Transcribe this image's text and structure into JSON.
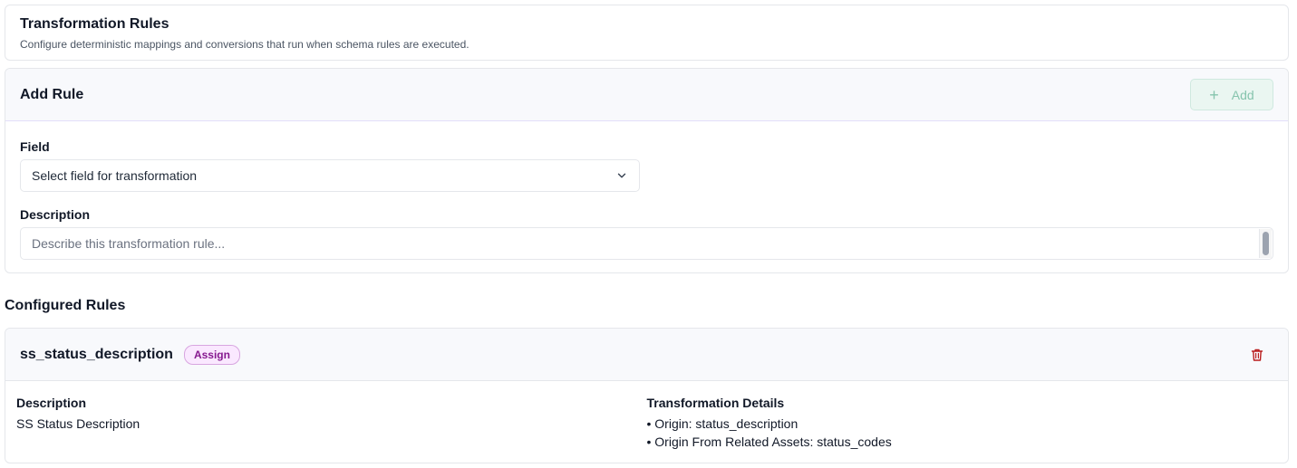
{
  "header": {
    "title": "Transformation Rules",
    "subtitle": "Configure deterministic mappings and conversions that run when schema rules are executed."
  },
  "add_rule": {
    "title": "Add Rule",
    "add_button_label": "Add",
    "field_label": "Field",
    "field_placeholder": "Select field for transformation",
    "description_label": "Description",
    "description_placeholder": "Describe this transformation rule..."
  },
  "configured": {
    "title": "Configured Rules",
    "rules": [
      {
        "name": "ss_status_description",
        "badge": "Assign",
        "description_label": "Description",
        "description": "SS Status Description",
        "details_label": "Transformation Details",
        "details": [
          "• Origin: status_description",
          "• Origin From Related Assets: status_codes"
        ]
      }
    ]
  },
  "colors": {
    "add_button_text": "#86c4ad",
    "badge_text": "#86198f",
    "trash_icon": "#b91c1c"
  }
}
